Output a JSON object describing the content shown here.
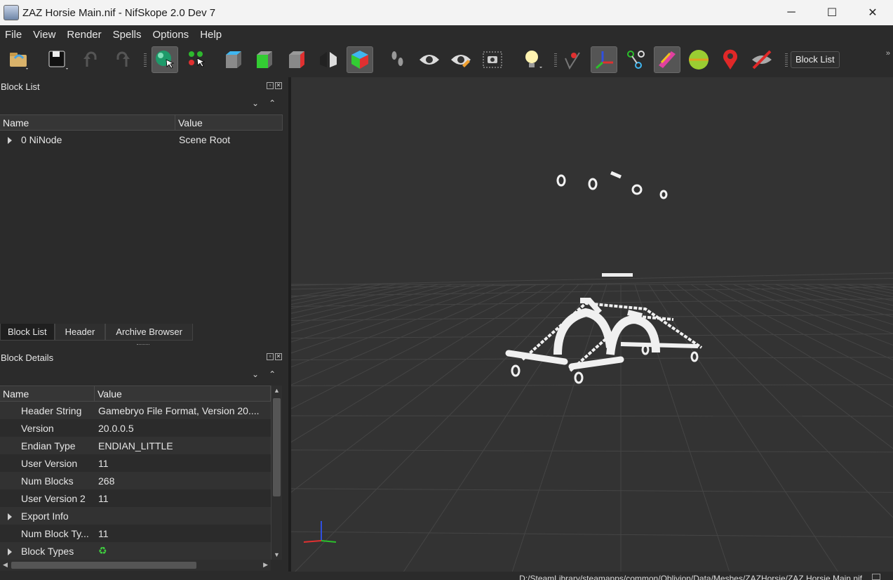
{
  "window": {
    "title": "ZAZ Horsie Main.nif - NifSkope 2.0 Dev 7",
    "minimize": "─",
    "maximize": "☐",
    "close": "✕"
  },
  "menu": [
    "File",
    "View",
    "Render",
    "Spells",
    "Options",
    "Help"
  ],
  "toolbar": {
    "block_list_label": "Block List",
    "more": "»",
    "icons": [
      "load-icon",
      "save-icon",
      "undo-icon",
      "redo-icon",
      "select-object-icon",
      "select-vertex-icon",
      "view-top-icon",
      "view-front-icon",
      "view-side-icon",
      "view-flip-icon",
      "view-user-icon",
      "walk-icon",
      "show-hidden-icon",
      "show-axes-icon",
      "screenshot-icon",
      "lighting-icon",
      "show-nodes-icon",
      "show-axes-gizmo-icon",
      "show-constraints-icon",
      "show-havok-icon",
      "show-bounds-icon",
      "show-markers-icon",
      "hide-markers-icon"
    ]
  },
  "block_list": {
    "title": "Block List",
    "columns": [
      "Name",
      "Value"
    ],
    "rows": [
      {
        "name": "0 NiNode",
        "value": "Scene Root",
        "expandable": true
      }
    ]
  },
  "tabs": [
    "Block List",
    "Header",
    "Archive Browser"
  ],
  "block_details": {
    "title": "Block Details",
    "columns": [
      "Name",
      "Value"
    ],
    "rows": [
      {
        "name": "Header String",
        "value": "Gamebryo File Format, Version 20....",
        "expandable": false
      },
      {
        "name": "Version",
        "value": "20.0.0.5",
        "expandable": false
      },
      {
        "name": "Endian Type",
        "value": "ENDIAN_LITTLE",
        "expandable": false
      },
      {
        "name": "User Version",
        "value": "11",
        "expandable": false
      },
      {
        "name": "Num Blocks",
        "value": "268",
        "expandable": false
      },
      {
        "name": "User Version 2",
        "value": "11",
        "expandable": false
      },
      {
        "name": "Export Info",
        "value": "",
        "expandable": true
      },
      {
        "name": "Num Block Ty...",
        "value": "11",
        "expandable": false
      },
      {
        "name": "Block Types",
        "value": "",
        "expandable": true
      }
    ]
  },
  "status": {
    "path": "D:/SteamLibrary/steamapps/common/Oblivion/Data/Meshes/ZAZHorsie/ZAZ Horsie Main.nif"
  },
  "colors": {
    "axis_x": "#e03030",
    "axis_y": "#2bc02b",
    "axis_z": "#3050e0",
    "viewport_bg": "#333333"
  }
}
